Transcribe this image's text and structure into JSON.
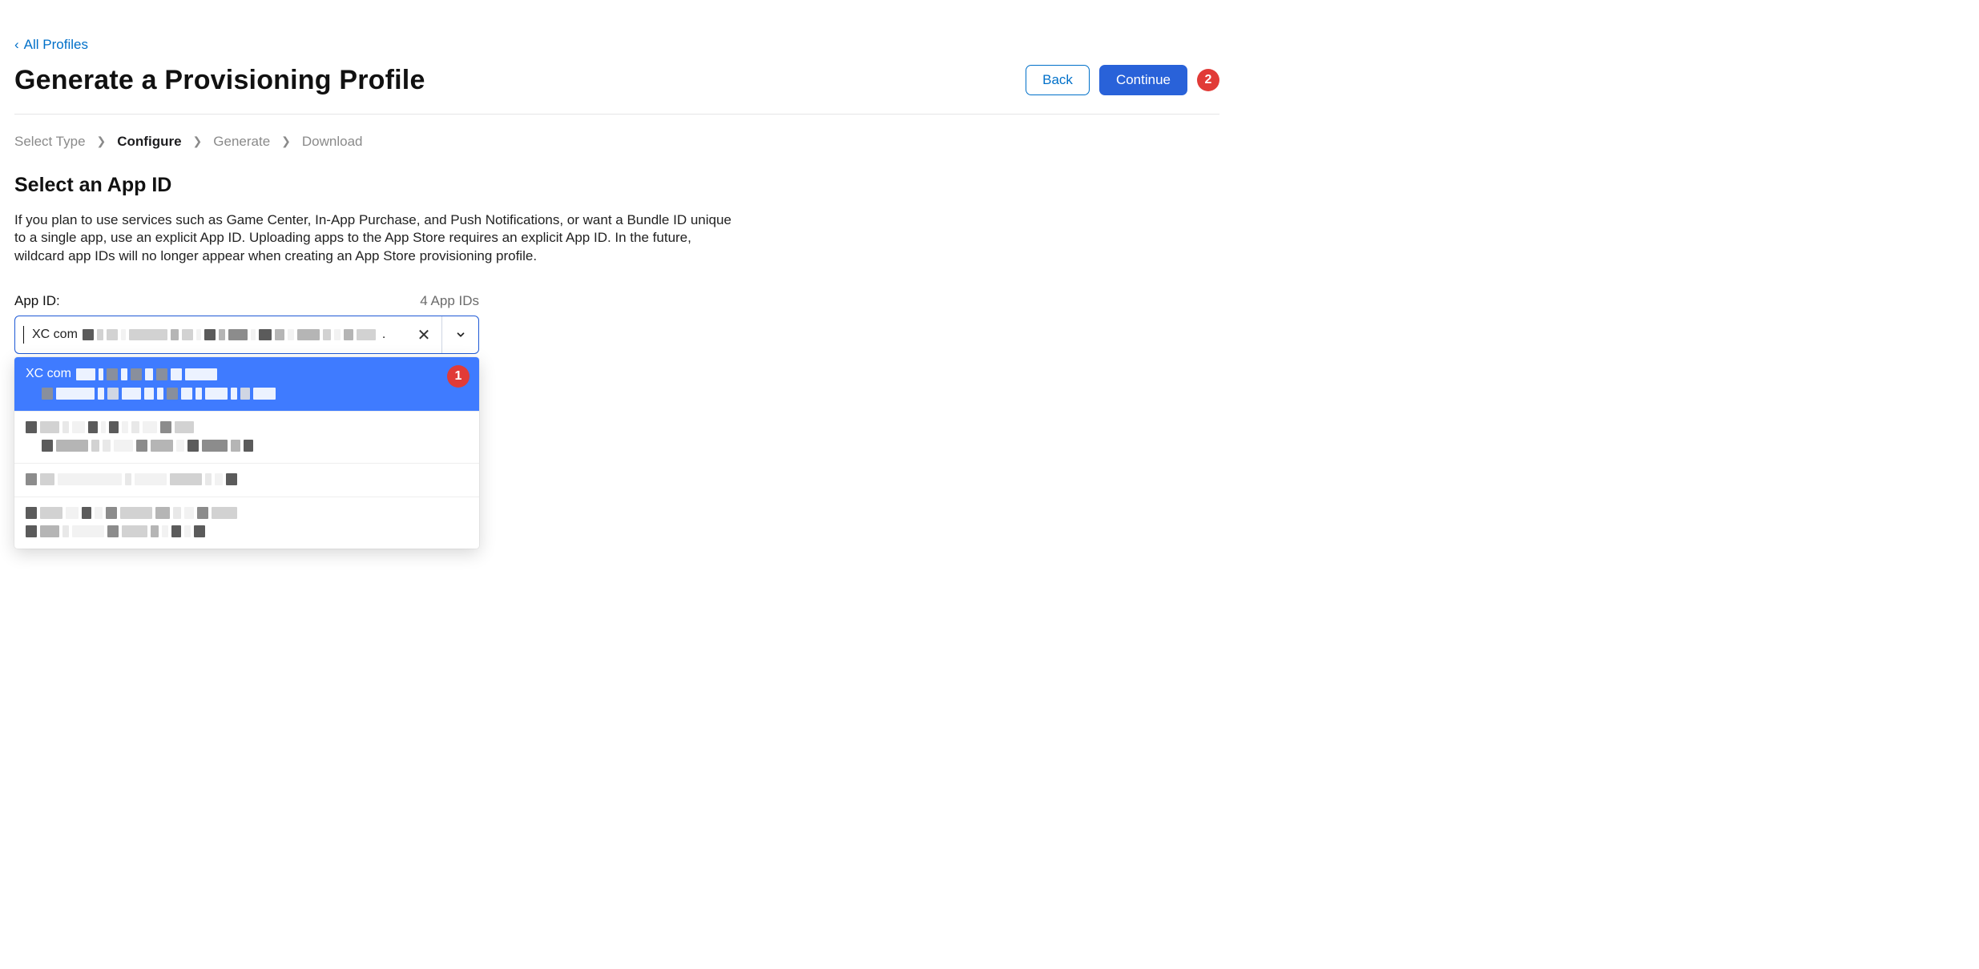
{
  "nav": {
    "back_link": "All Profiles"
  },
  "header": {
    "title": "Generate a Provisioning Profile",
    "buttons": {
      "back": "Back",
      "continue": "Continue"
    },
    "annotation_badge_2": "2"
  },
  "breadcrumb": {
    "items": [
      {
        "label": "Select Type",
        "active": false
      },
      {
        "label": "Configure",
        "active": true
      },
      {
        "label": "Generate",
        "active": false
      },
      {
        "label": "Download",
        "active": false
      }
    ]
  },
  "section": {
    "title": "Select an App ID",
    "description": "If you plan to use services such as Game Center, In-App Purchase, and Push Notifications, or want a Bundle ID unique to a single app, use an explicit App ID. Uploading apps to the App Store requires an explicit App ID. In the future, wildcard app IDs will no longer appear when creating an App Store provisioning profile."
  },
  "field": {
    "label": "App ID:",
    "count_text": "4 App IDs",
    "input_prefix": "XC com",
    "input_value_redacted": true,
    "input_trailing_dot": "."
  },
  "dropdown": {
    "annotation_badge_1": "1",
    "options": [
      {
        "prefix": "XC com",
        "selected": true,
        "line1_redacted": true,
        "line2_redacted": true
      },
      {
        "prefix": "",
        "selected": false,
        "line1_redacted": true,
        "line2_redacted": true
      },
      {
        "prefix": "",
        "selected": false,
        "line1_redacted": true,
        "line2_redacted": true
      },
      {
        "prefix": "",
        "selected": false,
        "line1_redacted": true,
        "line2_redacted": true
      }
    ]
  }
}
